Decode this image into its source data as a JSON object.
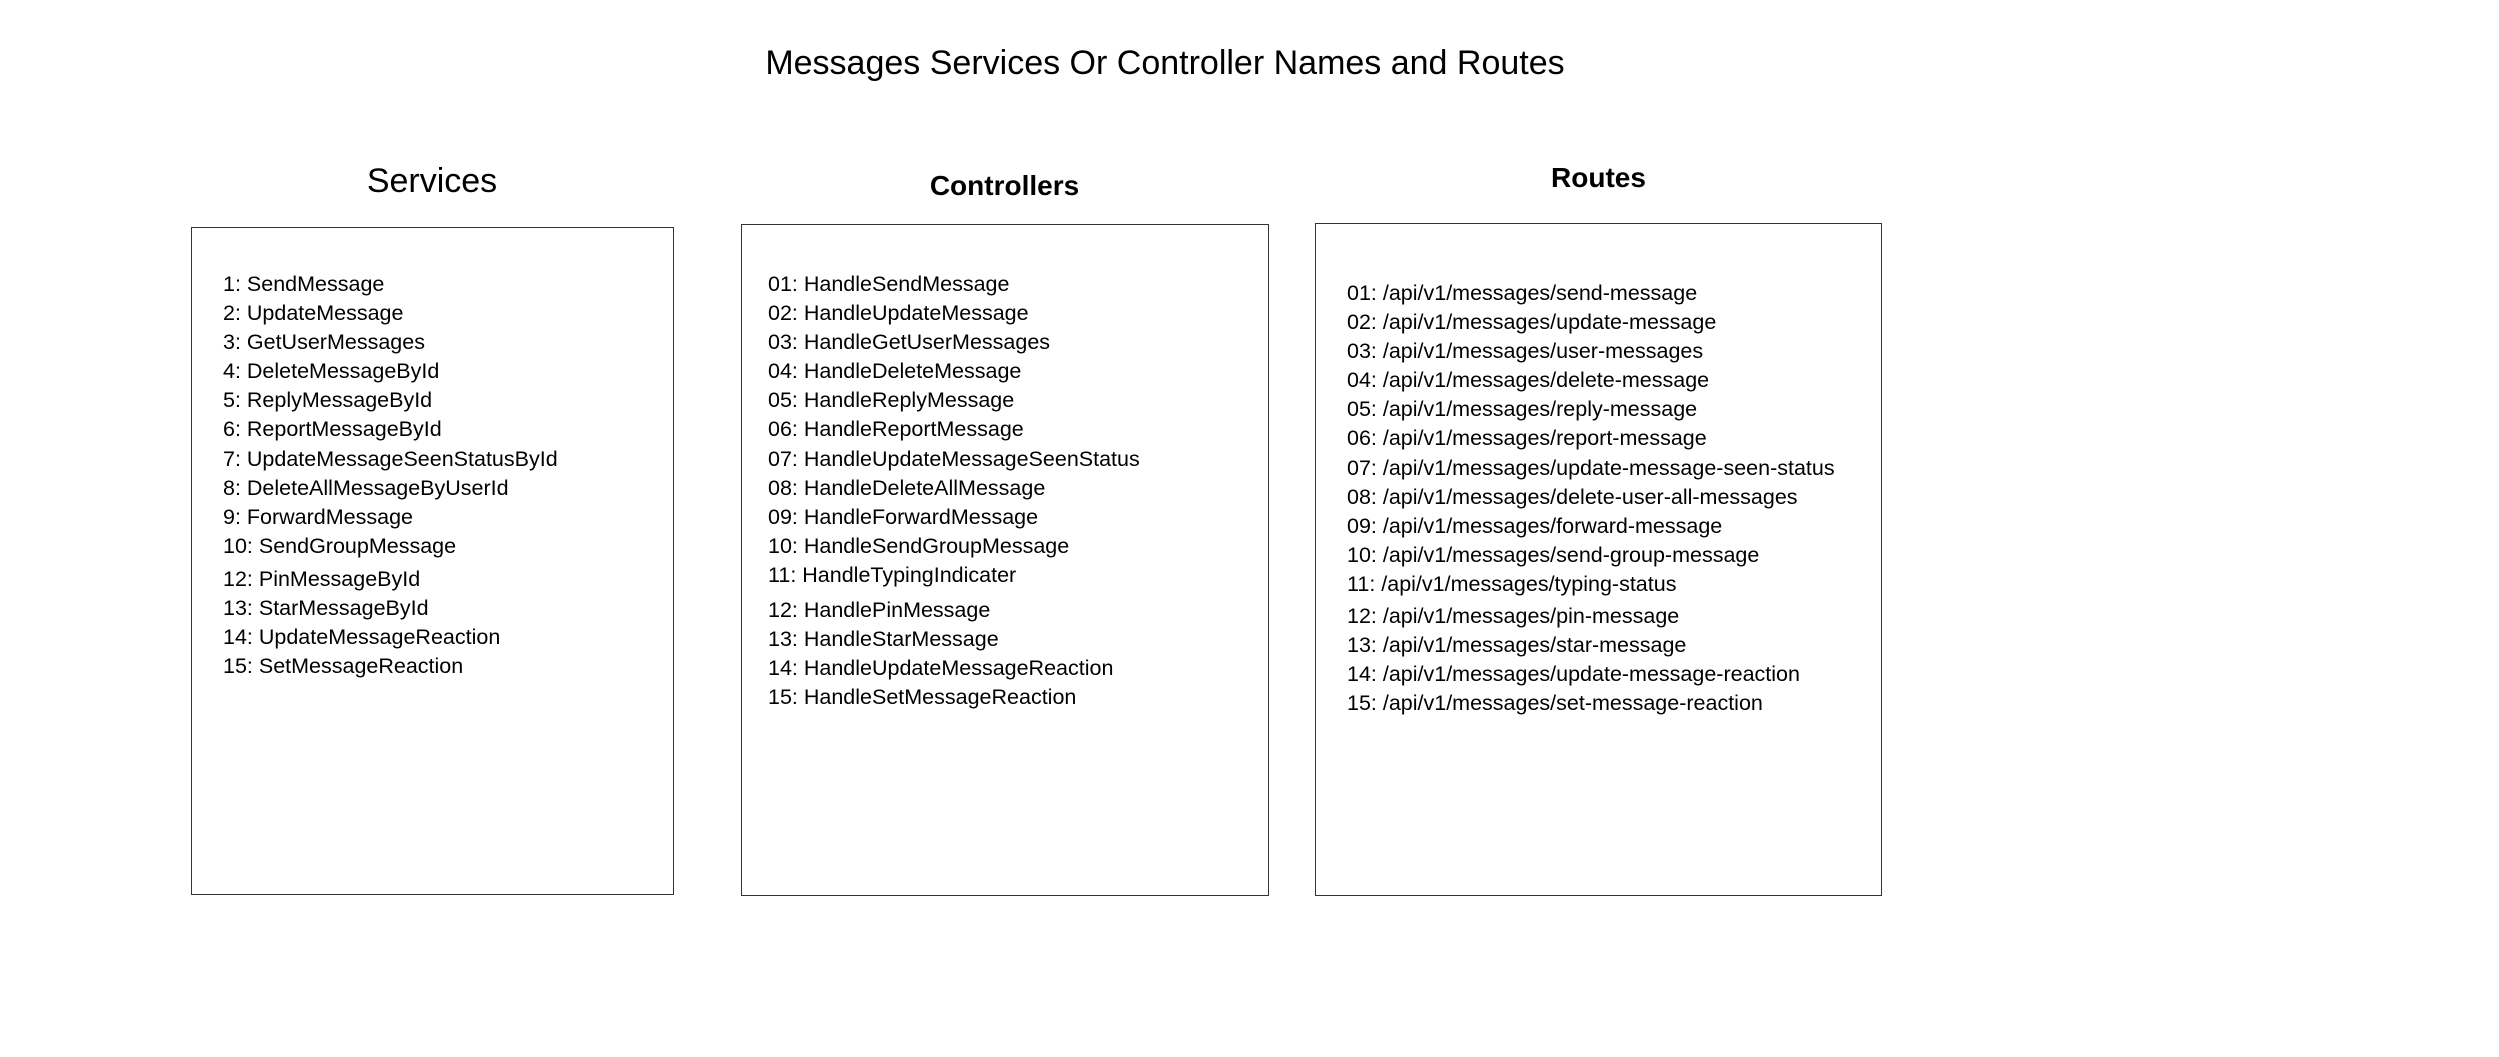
{
  "title": "Messages Services Or Controller Names and Routes",
  "columns": {
    "services": {
      "heading": "Services",
      "items": [
        "1: SendMessage",
        "2: UpdateMessage",
        "3: GetUserMessages",
        "4: DeleteMessageById",
        "5: ReplyMessageById",
        "6: ReportMessageById",
        "7: UpdateMessageSeenStatusById",
        "8: DeleteAllMessageByUserId",
        "9: ForwardMessage",
        "10: SendGroupMessage",
        "12: PinMessageById",
        "13: StarMessageById",
        "14: UpdateMessageReaction",
        "15: SetMessageReaction"
      ]
    },
    "controllers": {
      "heading": "Controllers",
      "items": [
        "01: HandleSendMessage",
        "02: HandleUpdateMessage",
        "03: HandleGetUserMessages",
        "04: HandleDeleteMessage",
        "05: HandleReplyMessage",
        "06: HandleReportMessage",
        "07: HandleUpdateMessageSeenStatus",
        "08: HandleDeleteAllMessage",
        "09: HandleForwardMessage",
        "10: HandleSendGroupMessage",
        "11: HandleTypingIndicater",
        "12: HandlePinMessage",
        "13: HandleStarMessage",
        "14: HandleUpdateMessageReaction",
        "15: HandleSetMessageReaction"
      ]
    },
    "routes": {
      "heading": "Routes",
      "items": [
        "01: /api/v1/messages/send-message",
        "02: /api/v1/messages/update-message",
        "03: /api/v1/messages/user-messages",
        "04: /api/v1/messages/delete-message",
        "05: /api/v1/messages/reply-message",
        "06: /api/v1/messages/report-message",
        "07: /api/v1/messages/update-message-seen-status",
        "08: /api/v1/messages/delete-user-all-messages",
        "09: /api/v1/messages/forward-message",
        "10: /api/v1/messages/send-group-message",
        "11: /api/v1/messages/typing-status",
        "12: /api/v1/messages/pin-message",
        "13: /api/v1/messages/star-message",
        "14: /api/v1/messages/update-message-reaction",
        "15: /api/v1/messages/set-message-reaction"
      ]
    }
  }
}
